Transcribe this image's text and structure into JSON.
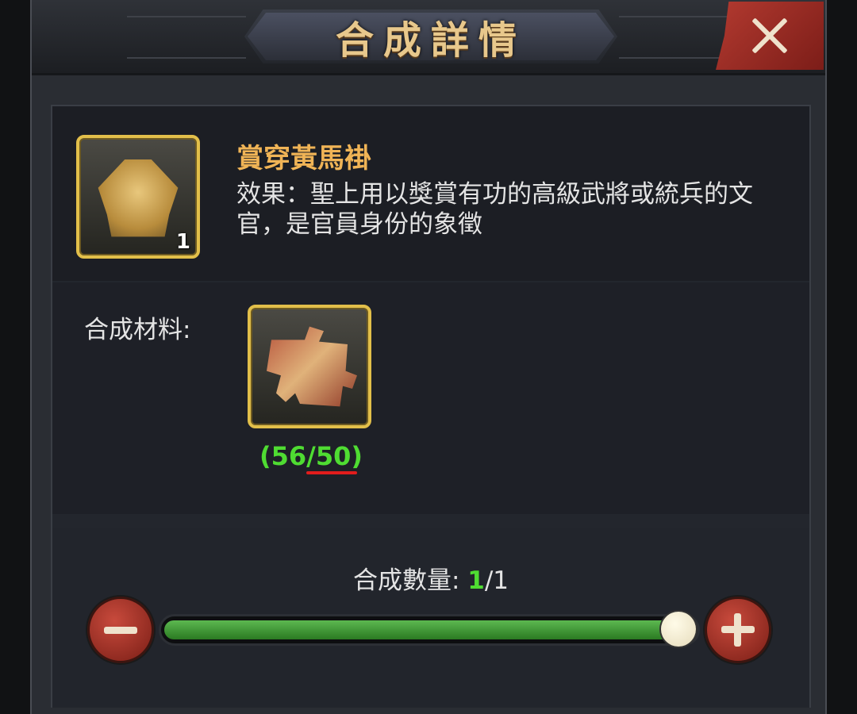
{
  "header": {
    "title": "合成詳情"
  },
  "item": {
    "name": "賞穿黃馬褂",
    "count": "1",
    "description": "效果：聖上用以獎賞有功的高級武將或統兵的文官，是官員身份的象徵",
    "icon": "jacket-icon"
  },
  "material": {
    "label": "合成材料:",
    "count_text": "(56/50)",
    "icon": "jacket-fragment-icon"
  },
  "quantity": {
    "label": "合成數量:",
    "current": "1",
    "max_text": "/1",
    "level": 1.0
  },
  "colors": {
    "accent_gold": "#e2bf4a",
    "item_name": "#f0b456",
    "count_green": "#4fdc32",
    "button_red": "#b33a30"
  }
}
